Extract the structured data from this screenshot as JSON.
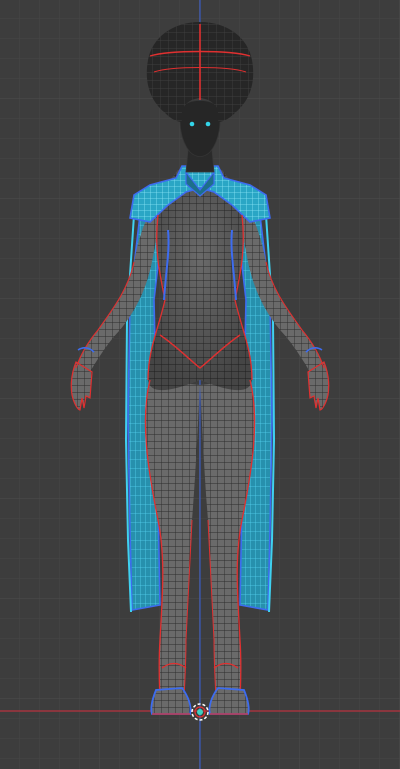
{
  "viewport": {
    "view": "front-orthographic",
    "background": "#3d3d3d",
    "grid_minor": "#434343",
    "grid_major": "#4c4c4c"
  },
  "axes": {
    "x_axis_color": "#b8333f",
    "z_axis_color": "#3a5bbf"
  },
  "model": {
    "mesh_display": "wireframe-overlay",
    "skin_color": "#6e6e6e",
    "hair_color": "#2b2b2b",
    "cape_color": "#2e9fbe",
    "cape_edge_color": "#3fd1f0",
    "seam_color": "#e03030",
    "selected_edge_color": "#3d6cf0",
    "eye_color": "#33d4e8"
  },
  "origin": {
    "icon": "object-origin-icon",
    "color": "#3fd1c1"
  }
}
